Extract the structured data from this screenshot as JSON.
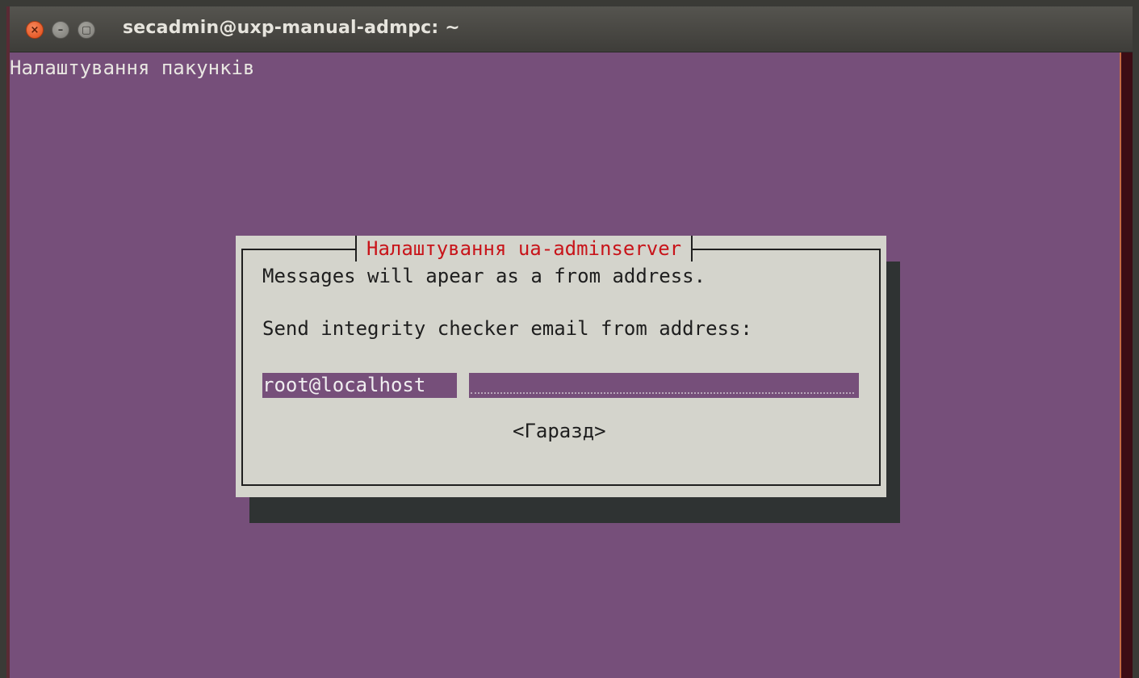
{
  "window": {
    "title": "secadmin@uxp-manual-admpc: ~",
    "buttons": {
      "close": "×",
      "minimize": "–",
      "maximize": "▢"
    }
  },
  "terminal": {
    "heading": "Налаштування пакунків"
  },
  "dialog": {
    "title": "Налаштування ua-adminserver",
    "message": "Messages will apear as a from address.",
    "prompt": "Send integrity checker email from address:",
    "input_value": "root@localhost",
    "ok_button": "<Гаразд>"
  },
  "colors": {
    "terminal_bg": "#764f7a",
    "dialog_bg": "#d4d4cc",
    "dialog_title": "#c8141a",
    "close_button": "#df4a16"
  },
  "icons": [
    "close-icon",
    "minimize-icon",
    "maximize-icon"
  ]
}
